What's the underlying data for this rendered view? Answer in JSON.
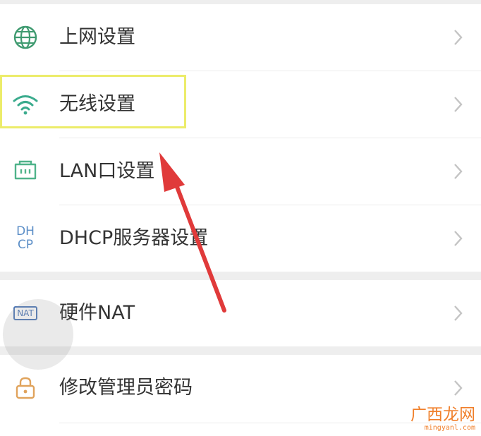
{
  "settings_list": {
    "items": [
      {
        "label": "上网设置",
        "icon": "globe-icon"
      },
      {
        "label": "无线设置",
        "icon": "wifi-icon"
      },
      {
        "label": "LAN口设置",
        "icon": "lan-port-icon"
      },
      {
        "label": "DHCP服务器设置",
        "icon": "dhcp-icon",
        "icon_text": [
          "DH",
          "CP"
        ]
      },
      {
        "label": "硬件NAT",
        "icon": "nat-icon",
        "icon_text": "NAT"
      },
      {
        "label": "修改管理员密码",
        "icon": "lock-icon"
      }
    ]
  },
  "highlight": {
    "target": "无线设置",
    "color": "#ecec6a"
  },
  "annotation_arrow": {
    "color": "#e03a3a"
  },
  "watermark": {
    "title": "广西龙网",
    "url": "mingyanl.com"
  }
}
